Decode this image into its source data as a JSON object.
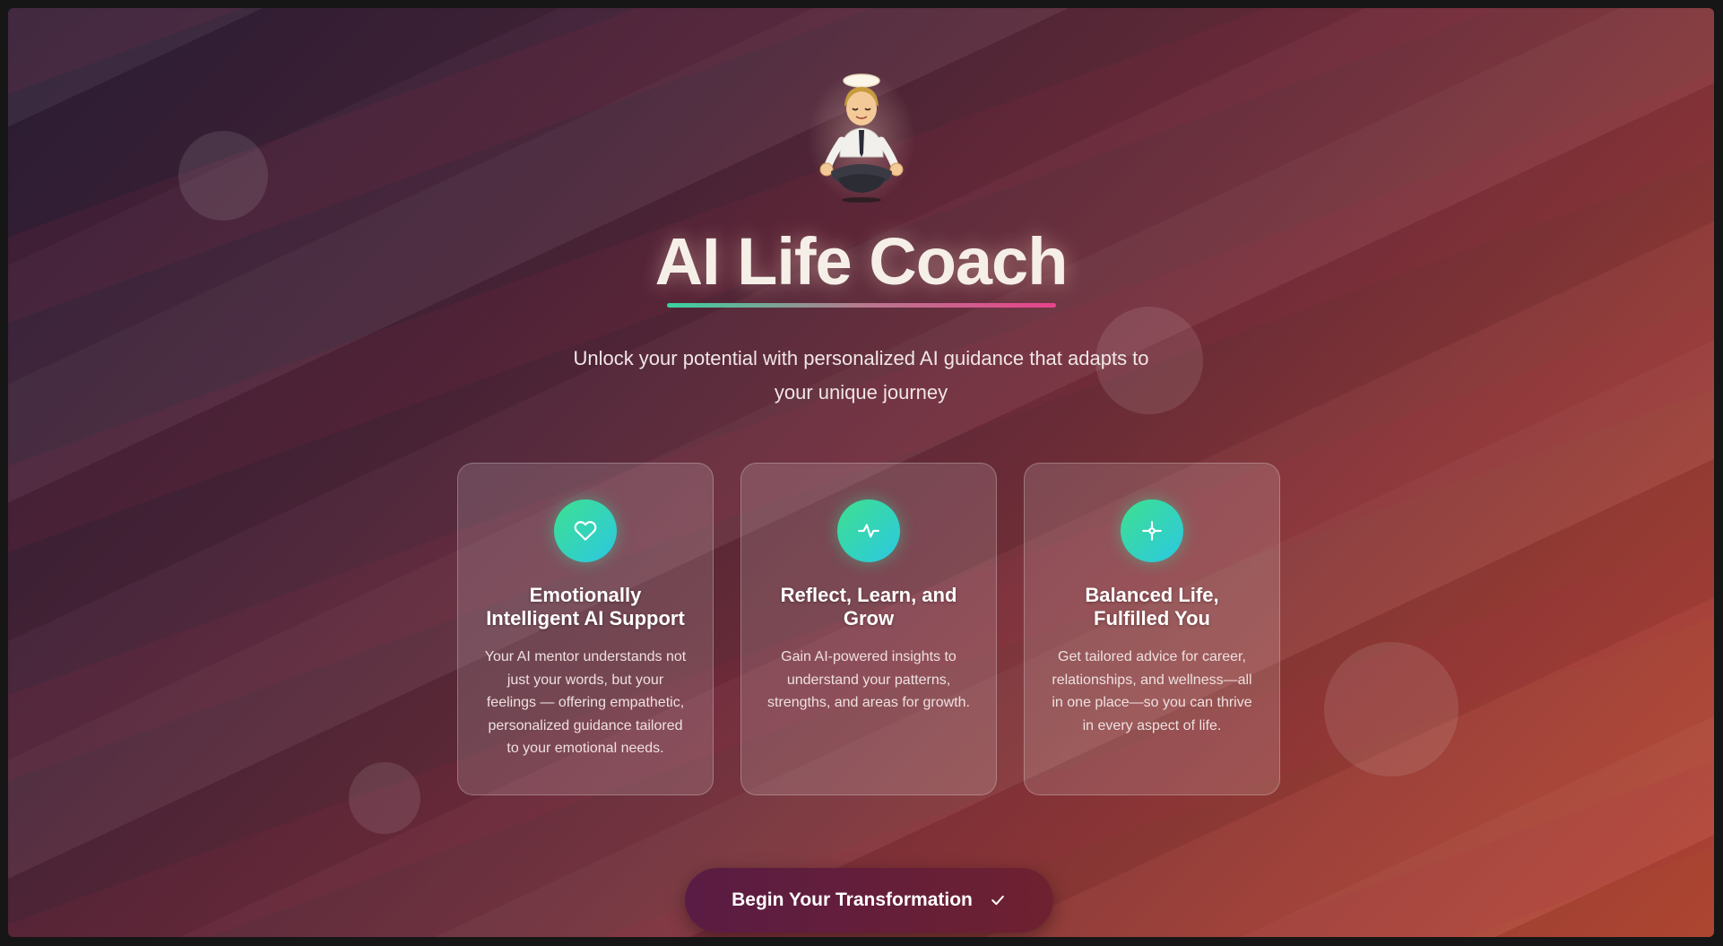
{
  "app": {
    "title": "AI Life Coach",
    "subtitle": "Unlock your potential with personalized AI guidance that adapts to your unique journey",
    "hero_icon": "meditating-person-with-halo-icon"
  },
  "features": [
    {
      "icon": "heart-icon",
      "title": "Emotionally Intelligent AI Support",
      "text": "Your AI mentor understands not just your words, but your feelings — offering empathetic, personalized guidance tailored to your emotional needs."
    },
    {
      "icon": "activity-pulse-icon",
      "title": "Reflect, Learn, and Grow",
      "text": "Gain AI-powered insights to understand your patterns, strengths, and areas for growth."
    },
    {
      "icon": "balance-crosshair-icon",
      "title": "Balanced Life, Fulfilled You",
      "text": "Get tailored advice for career, relationships, and wellness—all in one place—so you can thrive in every aspect of life."
    }
  ],
  "cta": {
    "label": "Begin Your Transformation",
    "icon": "check-icon"
  },
  "colors": {
    "accent_green": "#3ee08f",
    "accent_cyan": "#2bc8e2",
    "accent_pink": "#e8438c",
    "cta_background": "#5a1c44"
  }
}
